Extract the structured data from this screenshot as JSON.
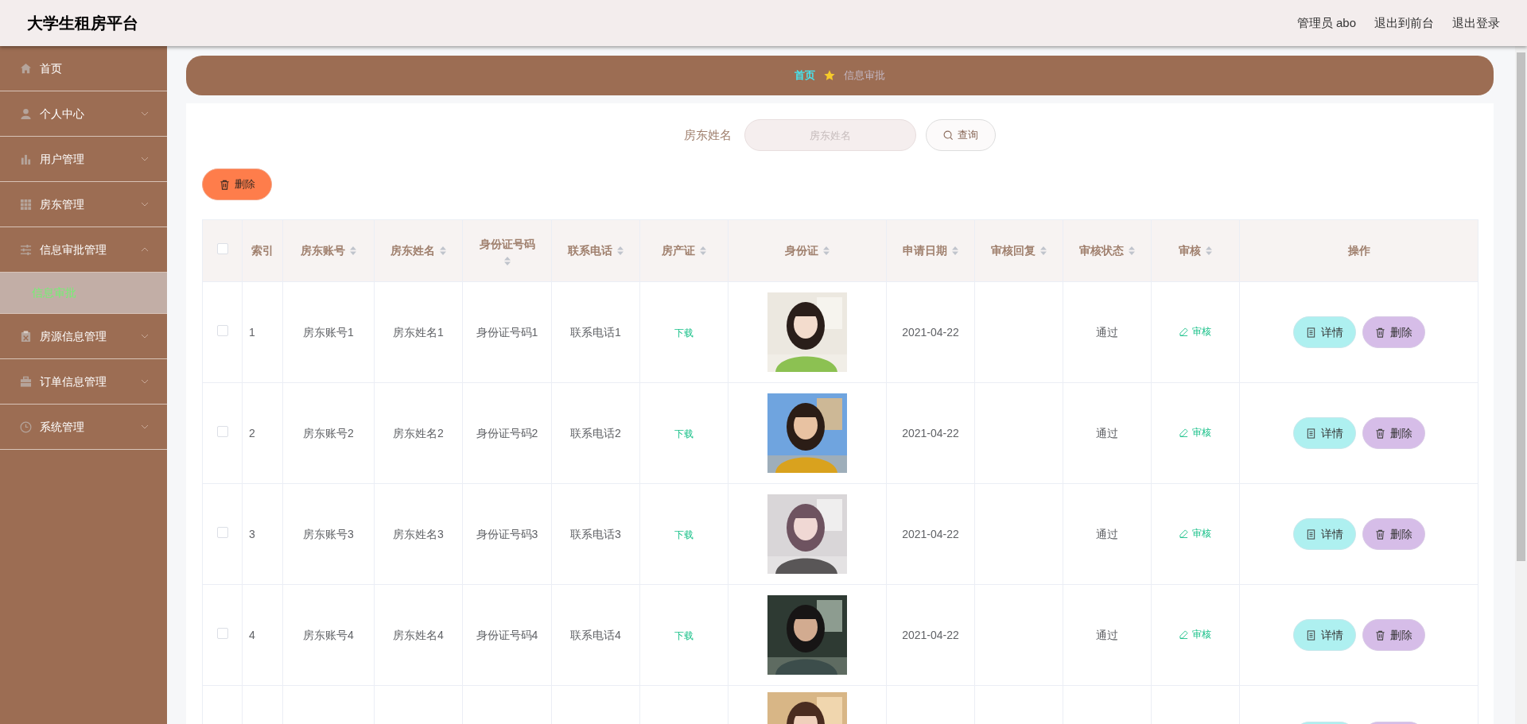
{
  "header": {
    "title": "大学生租房平台",
    "links": [
      "管理员 abo",
      "退出到前台",
      "退出登录"
    ]
  },
  "sidebar": {
    "items": [
      {
        "label": "首页",
        "kind": "link"
      },
      {
        "label": "个人中心",
        "kind": "menu",
        "expanded": false
      },
      {
        "label": "用户管理",
        "kind": "menu",
        "expanded": false
      },
      {
        "label": "房东管理",
        "kind": "menu",
        "expanded": false
      },
      {
        "label": "信息审批管理",
        "kind": "menu",
        "expanded": true,
        "children": [
          {
            "label": "信息审批",
            "selected": true
          }
        ]
      },
      {
        "label": "房源信息管理",
        "kind": "menu",
        "expanded": false
      },
      {
        "label": "订单信息管理",
        "kind": "menu",
        "expanded": false
      },
      {
        "label": "系统管理",
        "kind": "menu",
        "expanded": false
      }
    ]
  },
  "breadcrumb": [
    "首页",
    "信息审批"
  ],
  "search": {
    "label": "房东姓名",
    "placeholder": "房东姓名",
    "button": "查询"
  },
  "toolbar": {
    "delete_button": "删除"
  },
  "table": {
    "select_all": {
      "checked": false
    },
    "columns": [
      {
        "label": "索引",
        "sortable": false
      },
      {
        "label": "房东账号",
        "sortable": true
      },
      {
        "label": "房东姓名",
        "sortable": true
      },
      {
        "label": "身份证号码",
        "sortable": true
      },
      {
        "label": "联系电话",
        "sortable": true
      },
      {
        "label": "房产证",
        "sortable": true
      },
      {
        "label": "身份证",
        "sortable": true
      },
      {
        "label": "申请日期",
        "sortable": true
      },
      {
        "label": "审核回复",
        "sortable": true
      },
      {
        "label": "审核状态",
        "sortable": true
      },
      {
        "label": "审核",
        "sortable": true
      },
      {
        "label": "操作",
        "sortable": false
      }
    ],
    "rows": [
      {
        "kind": "full",
        "checked": false,
        "index": "1",
        "account": "房东账号1",
        "name": "房东姓名1",
        "id_number": "身份证号码1",
        "phone": "联系电话1",
        "deed": "下载",
        "photo": {
          "kind": "picture"
        },
        "date": "2021-04-22",
        "status": "通过",
        "review": "审核",
        "actions": [
          "详情",
          "删除"
        ]
      },
      {
        "kind": "full",
        "checked": false,
        "index": "2",
        "account": "房东账号2",
        "name": "房东姓名2",
        "id_number": "身份证号码2",
        "phone": "联系电话2",
        "deed": "下载",
        "photo": {
          "kind": "picture"
        },
        "date": "2021-04-22",
        "status": "通过",
        "review": "审核",
        "actions": [
          "详情",
          "删除"
        ]
      },
      {
        "kind": "full",
        "checked": false,
        "index": "3",
        "account": "房东账号3",
        "name": "房东姓名3",
        "id_number": "身份证号码3",
        "phone": "联系电话3",
        "deed": "下载",
        "photo": {
          "kind": "picture"
        },
        "date": "2021-04-22",
        "status": "通过",
        "review": "审核",
        "actions": [
          "详情",
          "删除"
        ]
      },
      {
        "kind": "full",
        "checked": false,
        "index": "4",
        "account": "房东账号4",
        "name": "房东姓名4",
        "id_number": "身份证号码4",
        "phone": "联系电话4",
        "deed": "下载",
        "photo": {
          "kind": "picture"
        },
        "date": "2021-04-22",
        "status": "通过",
        "review": "审核",
        "actions": [
          "详情",
          "删除"
        ]
      },
      {
        "kind": "partial",
        "photo": {
          "kind": "picture"
        }
      }
    ]
  }
}
